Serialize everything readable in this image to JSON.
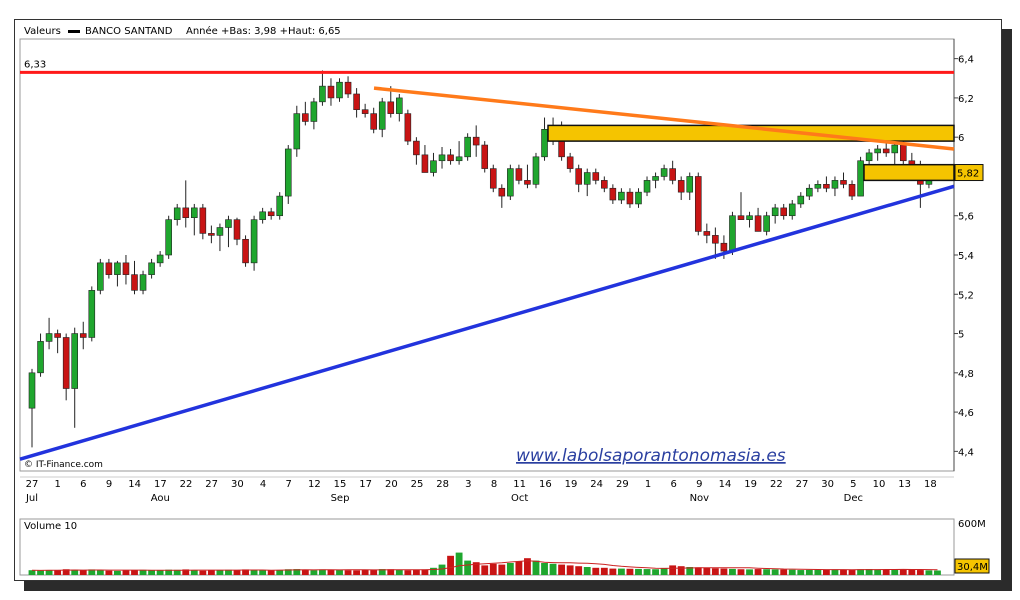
{
  "header": {
    "valeurs_label": "Valeurs",
    "ticker": "BANCO SANTAND",
    "range_text": "Année +Bas: 3,98 +Haut: 6,65"
  },
  "watermark": "www.labolsaporantonomasia.es",
  "source_label": "© IT-Finance.com",
  "price_tags": {
    "resistance": "6,33",
    "last": "5,82"
  },
  "colors": {
    "up": "#1fa62e",
    "down": "#c81414",
    "resistance": "#ff1a1a",
    "down_trend": "#ff7a1a",
    "up_trend": "#2233dd",
    "zone": "#f5c400",
    "avg": "#cc2222"
  },
  "chart_data": {
    "type": "candlestick",
    "ylim": [
      4.3,
      6.5
    ],
    "y_ticks": [
      "4,4",
      "4,6",
      "4,8",
      "5",
      "5,2",
      "5,4",
      "5,6",
      "5,82",
      "6",
      "6,2",
      "6,4"
    ],
    "x_ticks": [
      "27",
      "1",
      "6",
      "9",
      "14",
      "17",
      "22",
      "27",
      "30",
      "4",
      "7",
      "12",
      "15",
      "17",
      "20",
      "25",
      "28",
      "3",
      "8",
      "11",
      "16",
      "19",
      "24",
      "29",
      "1",
      "6",
      "9",
      "14",
      "19",
      "22",
      "27",
      "30",
      "5",
      "10",
      "13",
      "18"
    ],
    "month_labels": [
      "Jul",
      "Aou",
      "Sep",
      "Oct",
      "Nov",
      "Dec"
    ],
    "candles": [
      [
        4.62,
        4.82,
        4.42,
        4.8
      ],
      [
        4.8,
        5.0,
        4.78,
        4.96
      ],
      [
        4.96,
        5.08,
        4.92,
        5.0
      ],
      [
        5.0,
        5.02,
        4.9,
        4.98
      ],
      [
        4.98,
        5.0,
        4.66,
        4.72
      ],
      [
        4.72,
        5.03,
        4.52,
        5.0
      ],
      [
        5.0,
        5.06,
        4.92,
        4.98
      ],
      [
        4.98,
        5.24,
        4.96,
        5.22
      ],
      [
        5.22,
        5.38,
        5.2,
        5.36
      ],
      [
        5.36,
        5.38,
        5.28,
        5.3
      ],
      [
        5.3,
        5.37,
        5.24,
        5.36
      ],
      [
        5.36,
        5.4,
        5.25,
        5.3
      ],
      [
        5.3,
        5.37,
        5.2,
        5.22
      ],
      [
        5.22,
        5.32,
        5.2,
        5.3
      ],
      [
        5.3,
        5.38,
        5.28,
        5.36
      ],
      [
        5.36,
        5.42,
        5.34,
        5.4
      ],
      [
        5.4,
        5.6,
        5.38,
        5.58
      ],
      [
        5.58,
        5.66,
        5.55,
        5.64
      ],
      [
        5.64,
        5.78,
        5.54,
        5.59
      ],
      [
        5.59,
        5.66,
        5.5,
        5.64
      ],
      [
        5.64,
        5.66,
        5.48,
        5.51
      ],
      [
        5.51,
        5.55,
        5.46,
        5.5
      ],
      [
        5.5,
        5.56,
        5.42,
        5.54
      ],
      [
        5.54,
        5.6,
        5.44,
        5.58
      ],
      [
        5.58,
        5.59,
        5.45,
        5.48
      ],
      [
        5.48,
        5.5,
        5.34,
        5.36
      ],
      [
        5.36,
        5.6,
        5.32,
        5.58
      ],
      [
        5.58,
        5.64,
        5.56,
        5.62
      ],
      [
        5.62,
        5.64,
        5.58,
        5.6
      ],
      [
        5.6,
        5.72,
        5.58,
        5.7
      ],
      [
        5.7,
        5.96,
        5.66,
        5.94
      ],
      [
        5.94,
        6.16,
        5.9,
        6.12
      ],
      [
        6.12,
        6.18,
        6.06,
        6.08
      ],
      [
        6.08,
        6.2,
        6.04,
        6.18
      ],
      [
        6.18,
        6.34,
        6.16,
        6.26
      ],
      [
        6.26,
        6.3,
        6.16,
        6.2
      ],
      [
        6.2,
        6.3,
        6.18,
        6.28
      ],
      [
        6.28,
        6.31,
        6.2,
        6.22
      ],
      [
        6.22,
        6.25,
        6.1,
        6.14
      ],
      [
        6.14,
        6.17,
        6.1,
        6.12
      ],
      [
        6.12,
        6.15,
        6.02,
        6.04
      ],
      [
        6.04,
        6.2,
        6.0,
        6.18
      ],
      [
        6.18,
        6.26,
        6.1,
        6.12
      ],
      [
        6.12,
        6.22,
        6.08,
        6.2
      ],
      [
        6.12,
        6.14,
        5.96,
        5.98
      ],
      [
        5.98,
        6.0,
        5.86,
        5.91
      ],
      [
        5.91,
        5.96,
        5.86,
        5.82
      ],
      [
        5.82,
        5.92,
        5.8,
        5.88
      ],
      [
        5.88,
        5.95,
        5.84,
        5.91
      ],
      [
        5.91,
        5.94,
        5.86,
        5.88
      ],
      [
        5.88,
        5.98,
        5.86,
        5.9
      ],
      [
        5.9,
        6.02,
        5.88,
        6.0
      ],
      [
        6.0,
        6.06,
        5.9,
        5.96
      ],
      [
        5.96,
        5.98,
        5.82,
        5.84
      ],
      [
        5.84,
        5.86,
        5.72,
        5.74
      ],
      [
        5.74,
        5.76,
        5.64,
        5.7
      ],
      [
        5.7,
        5.86,
        5.68,
        5.84
      ],
      [
        5.84,
        5.86,
        5.76,
        5.78
      ],
      [
        5.78,
        5.86,
        5.74,
        5.76
      ],
      [
        5.76,
        5.92,
        5.74,
        5.9
      ],
      [
        5.9,
        6.1,
        5.88,
        6.04
      ],
      [
        6.04,
        6.1,
        5.96,
        6.06
      ],
      [
        6.06,
        6.08,
        5.88,
        5.9
      ],
      [
        5.9,
        5.92,
        5.82,
        5.84
      ],
      [
        5.84,
        5.86,
        5.72,
        5.76
      ],
      [
        5.76,
        5.84,
        5.7,
        5.82
      ],
      [
        5.82,
        5.84,
        5.76,
        5.78
      ],
      [
        5.78,
        5.8,
        5.72,
        5.74
      ],
      [
        5.74,
        5.76,
        5.66,
        5.68
      ],
      [
        5.68,
        5.74,
        5.66,
        5.72
      ],
      [
        5.72,
        5.74,
        5.64,
        5.66
      ],
      [
        5.66,
        5.74,
        5.64,
        5.72
      ],
      [
        5.72,
        5.8,
        5.7,
        5.78
      ],
      [
        5.78,
        5.82,
        5.74,
        5.8
      ],
      [
        5.8,
        5.86,
        5.78,
        5.84
      ],
      [
        5.84,
        5.88,
        5.76,
        5.78
      ],
      [
        5.78,
        5.8,
        5.68,
        5.72
      ],
      [
        5.72,
        5.82,
        5.68,
        5.8
      ],
      [
        5.8,
        5.82,
        5.5,
        5.52
      ],
      [
        5.52,
        5.56,
        5.46,
        5.5
      ],
      [
        5.5,
        5.54,
        5.38,
        5.46
      ],
      [
        5.46,
        5.5,
        5.38,
        5.42
      ],
      [
        5.42,
        5.62,
        5.4,
        5.6
      ],
      [
        5.6,
        5.72,
        5.58,
        5.58
      ],
      [
        5.58,
        5.62,
        5.54,
        5.6
      ],
      [
        5.6,
        5.64,
        5.52,
        5.52
      ],
      [
        5.52,
        5.62,
        5.5,
        5.6
      ],
      [
        5.6,
        5.66,
        5.56,
        5.64
      ],
      [
        5.64,
        5.66,
        5.58,
        5.6
      ],
      [
        5.6,
        5.68,
        5.58,
        5.66
      ],
      [
        5.66,
        5.72,
        5.64,
        5.7
      ],
      [
        5.7,
        5.76,
        5.68,
        5.74
      ],
      [
        5.74,
        5.78,
        5.72,
        5.76
      ],
      [
        5.76,
        5.8,
        5.72,
        5.74
      ],
      [
        5.74,
        5.8,
        5.7,
        5.78
      ],
      [
        5.78,
        5.82,
        5.74,
        5.76
      ],
      [
        5.76,
        5.78,
        5.68,
        5.7
      ],
      [
        5.7,
        5.9,
        5.7,
        5.88
      ],
      [
        5.88,
        5.94,
        5.86,
        5.92
      ],
      [
        5.92,
        5.96,
        5.88,
        5.94
      ],
      [
        5.94,
        5.98,
        5.9,
        5.92
      ],
      [
        5.92,
        5.98,
        5.86,
        5.96
      ],
      [
        5.96,
        5.98,
        5.86,
        5.88
      ],
      [
        5.88,
        5.92,
        5.78,
        5.84
      ],
      [
        5.84,
        5.88,
        5.64,
        5.76
      ],
      [
        5.76,
        5.82,
        5.74,
        5.8
      ],
      [
        5.8,
        5.84,
        5.78,
        5.82
      ]
    ],
    "resistance_level": 6.33,
    "zones": [
      [
        5.98,
        6.06
      ],
      [
        5.78,
        5.86
      ]
    ],
    "volume_label": "Volume 10",
    "volume_axis": [
      "600M",
      "30,4M"
    ],
    "volume": [
      60,
      55,
      62,
      58,
      72,
      66,
      58,
      70,
      62,
      54,
      52,
      56,
      60,
      64,
      58,
      62,
      66,
      64,
      70,
      56,
      54,
      62,
      58,
      64,
      60,
      70,
      68,
      58,
      56,
      60,
      72,
      74,
      64,
      60,
      70,
      66,
      62,
      60,
      58,
      66,
      62,
      74,
      72,
      66,
      60,
      64,
      70,
      90,
      130,
      240,
      280,
      180,
      160,
      120,
      140,
      130,
      150,
      170,
      210,
      180,
      150,
      140,
      130,
      120,
      110,
      100,
      90,
      90,
      80,
      80,
      78,
      76,
      74,
      72,
      88,
      120,
      110,
      100,
      96,
      90,
      84,
      80,
      76,
      72,
      70,
      74,
      72,
      70,
      68,
      66,
      62,
      64,
      66,
      68,
      70,
      68,
      66,
      72,
      74,
      70,
      68,
      66,
      72,
      64,
      62,
      58,
      56
    ]
  }
}
